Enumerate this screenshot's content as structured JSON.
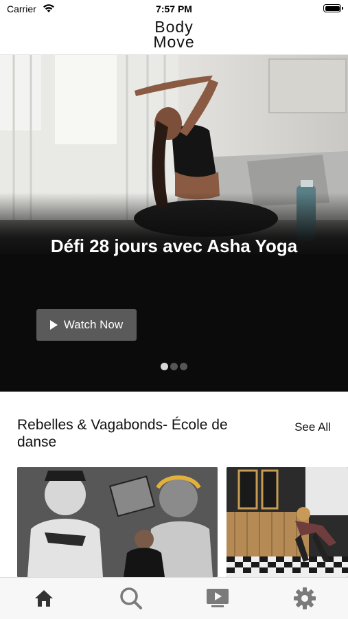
{
  "status_bar": {
    "carrier": "Carrier",
    "time": "7:57 PM"
  },
  "header": {
    "logo_line1": "Body",
    "logo_line2": "Move"
  },
  "hero": {
    "title": "Défi 28 jours avec Asha Yoga",
    "button_label": "Watch Now",
    "pages": 3,
    "active_page": 1
  },
  "section": {
    "title": "Rebelles & Vagabonds- École de danse",
    "see_all": "See All"
  },
  "tabbar": {
    "items": [
      {
        "icon": "home-icon",
        "active": true
      },
      {
        "icon": "search-icon",
        "active": false
      },
      {
        "icon": "video-play-icon",
        "active": false
      },
      {
        "icon": "settings-gear-icon",
        "active": false
      }
    ]
  },
  "colors": {
    "hero_bg": "#0b0b0b",
    "button_bg": "#5a5a5a",
    "tab_active": "#333333",
    "tab_inactive": "#7a7a7a"
  }
}
